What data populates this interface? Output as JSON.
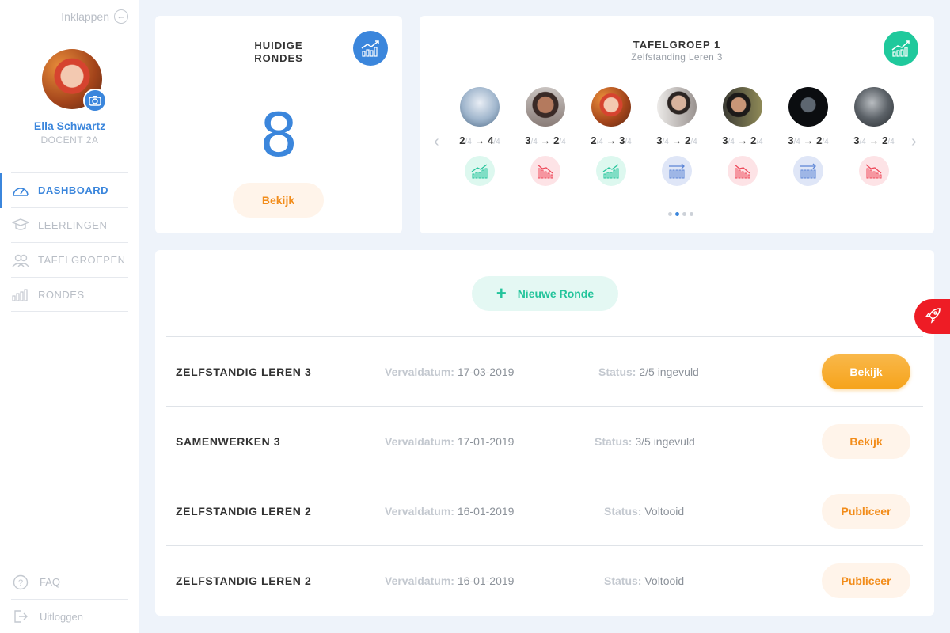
{
  "sidebar": {
    "collapse_label": "Inklappen",
    "user_name": "Ella Schwartz",
    "user_role": "DOCENT 2A",
    "nav": [
      {
        "label": "DASHBOARD",
        "icon": "speedometer-icon",
        "active": true
      },
      {
        "label": "LEERLINGEN",
        "icon": "graduation-cap-icon",
        "active": false
      },
      {
        "label": "TAFELGROEPEN",
        "icon": "group-icon",
        "active": false
      },
      {
        "label": "RONDES",
        "icon": "bar-chart-icon",
        "active": false
      }
    ],
    "bottom": [
      {
        "label": "FAQ",
        "icon": "question-icon"
      },
      {
        "label": "Uitloggen",
        "icon": "logout-icon"
      }
    ]
  },
  "current_rounds": {
    "title_line1": "HUIDIGE",
    "title_line2": "RONDES",
    "count": "8",
    "button_label": "Bekijk"
  },
  "table_group": {
    "title": "TAFELGROEP 1",
    "subtitle": "Zelfstanding Leren 3",
    "students": [
      {
        "from": "2",
        "to": "4",
        "max": "/4",
        "trend": "up"
      },
      {
        "from": "3",
        "to": "2",
        "max": "/4",
        "trend": "down"
      },
      {
        "from": "2",
        "to": "3",
        "max": "/4",
        "trend": "up"
      },
      {
        "from": "3",
        "to": "2",
        "max": "/4",
        "trend": "flat"
      },
      {
        "from": "3",
        "to": "2",
        "max": "/4",
        "trend": "down"
      },
      {
        "from": "3",
        "to": "2",
        "max": "/4",
        "trend": "flat"
      },
      {
        "from": "3",
        "to": "2",
        "max": "/4",
        "trend": "down"
      }
    ],
    "page_count": 4,
    "active_page": 2
  },
  "rounds": {
    "new_round_label": "Nieuwe Ronde",
    "due_label": "Vervaldatum:",
    "status_label": "Status:",
    "items": [
      {
        "name": "ZELFSTANDIG LEREN 3",
        "due": "17-03-2019",
        "status": "2/5 ingevuld",
        "action": "Bekijk",
        "highlight": true
      },
      {
        "name": "SAMENWERKEN 3",
        "due": "17-01-2019",
        "status": "3/5 ingevuld",
        "action": "Bekijk",
        "highlight": false
      },
      {
        "name": "ZELFSTANDIG LEREN 2",
        "due": "16-01-2019",
        "status": "Voltooid",
        "action": "Publiceer",
        "highlight": false
      },
      {
        "name": "ZELFSTANDIG LEREN 2",
        "due": "16-01-2019",
        "status": "Voltooid",
        "action": "Publiceer",
        "highlight": false
      }
    ]
  },
  "colors": {
    "primary": "#3b86dc",
    "accent_green": "#23c49b",
    "accent_orange": "#f6a31b",
    "accent_red": "#ee1c25"
  }
}
